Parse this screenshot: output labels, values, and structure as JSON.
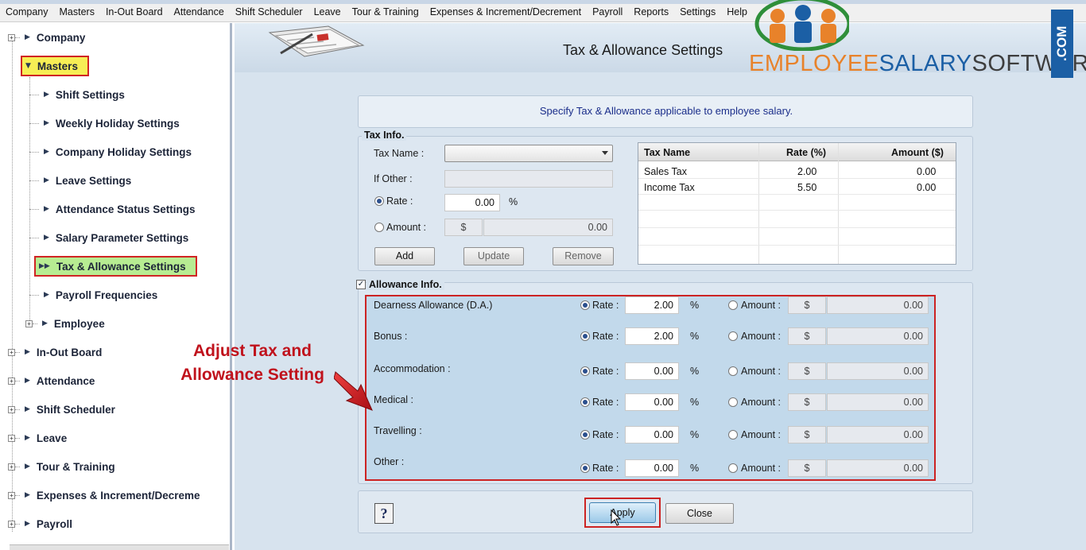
{
  "menu": [
    "Company",
    "Masters",
    "In-Out Board",
    "Attendance",
    "Shift Scheduler",
    "Leave",
    "Tour & Training",
    "Expenses & Increment/Decrement",
    "Payroll",
    "Reports",
    "Settings",
    "Help"
  ],
  "sidebar": {
    "company": "Company",
    "masters": "Masters",
    "children": [
      "Shift Settings",
      "Weekly Holiday Settings",
      "Company Holiday Settings",
      "Leave Settings",
      "Attendance Status Settings",
      "Salary Parameter Settings",
      "Tax & Allowance Settings",
      "Payroll Frequencies",
      "Employee"
    ],
    "bottom": [
      "In-Out Board",
      "Attendance",
      "Shift Scheduler",
      "Leave",
      "Tour & Training",
      "Expenses & Increment/Decreme",
      "Payroll"
    ]
  },
  "header": {
    "title": "Tax & Allowance Settings"
  },
  "logo": {
    "word1": "EMPLOYEE",
    "word2": "SALARY",
    "word3": "SOFTWARE",
    "com": ".COM",
    "colors": {
      "employee": "#e8822a",
      "salary": "#1b5fa5",
      "software": "#3d3d3d"
    }
  },
  "hint": "Specify Tax & Allowance applicable to employee salary.",
  "tax": {
    "legend": "Tax Info.",
    "name_label": "Tax Name :",
    "name_value": "",
    "other_label": "If Other :",
    "other_value": "",
    "rate_label": "Rate :",
    "rate_value": "0.00",
    "rate_unit": "%",
    "amount_label": "Amount :",
    "amount_currency": "$",
    "amount_value": "0.00",
    "add": "Add",
    "update": "Update",
    "remove": "Remove",
    "table": {
      "headers": [
        "Tax Name",
        "Rate (%)",
        "Amount ($)"
      ],
      "rows": [
        {
          "name": "Sales Tax",
          "rate": "2.00",
          "amount": "0.00"
        },
        {
          "name": "Income Tax",
          "rate": "5.50",
          "amount": "0.00"
        }
      ]
    }
  },
  "allowance": {
    "legend": "Allowance Info.",
    "checked": true,
    "rate_label": "Rate :",
    "amount_label": "Amount :",
    "pct": "%",
    "currency": "$",
    "items": [
      {
        "name": "Dearness Allowance (D.A.)",
        "rate": "2.00",
        "amount": "0.00"
      },
      {
        "name": "Bonus :",
        "rate": "2.00",
        "amount": "0.00"
      },
      {
        "name": "Accommodation :",
        "rate": "0.00",
        "amount": "0.00"
      },
      {
        "name": "Medical :",
        "rate": "0.00",
        "amount": "0.00"
      },
      {
        "name": "Travelling :",
        "rate": "0.00",
        "amount": "0.00"
      },
      {
        "name": "Other :",
        "rate": "0.00",
        "amount": "0.00"
      }
    ]
  },
  "annotation": {
    "line1": "Adjust Tax and",
    "line2": "Allowance Setting"
  },
  "help": "?",
  "apply": "Apply",
  "close": "Close"
}
